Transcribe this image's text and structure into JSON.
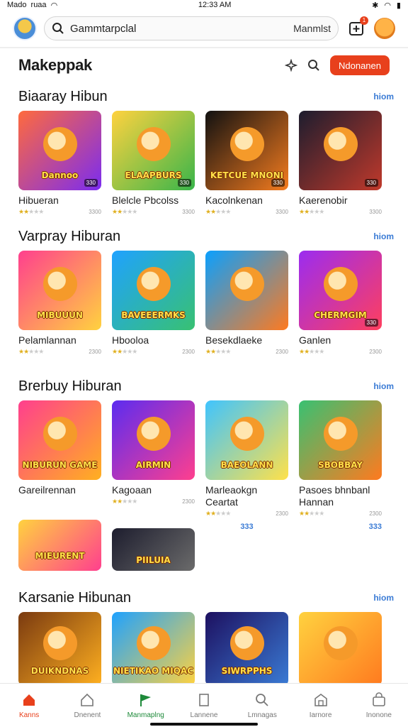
{
  "status_bar": {
    "carrier": "Mado",
    "signal_text": "ruaa",
    "time": "12:33 AM"
  },
  "search": {
    "query": "Gammtarpclal",
    "tag": "Manmlst"
  },
  "notifications_badge": "1",
  "header": {
    "title": "Makeppak",
    "cta": "Ndonanen"
  },
  "sections": [
    {
      "title": "Biaaray Hibun",
      "more": "hiom",
      "items": [
        {
          "name": "Hibueran",
          "thumb_title": "Dannoo",
          "corner": "330",
          "rating": 2,
          "meta": "3300",
          "colors": [
            "#ff6a3d",
            "#7b2cf0"
          ]
        },
        {
          "name": "Blelcle Pbcolss",
          "thumb_title": "ELAAPBURS",
          "corner": "330",
          "rating": 2,
          "meta": "3300",
          "colors": [
            "#ffd23f",
            "#39b54a"
          ]
        },
        {
          "name": "Kacolnkenan",
          "thumb_title": "KETCUE MNONI",
          "corner": "330",
          "rating": 2,
          "meta": "3300",
          "colors": [
            "#111111",
            "#f57c1f"
          ]
        },
        {
          "name": "Kaerenobir",
          "thumb_title": "",
          "corner": "330",
          "rating": 2,
          "meta": "3300",
          "colors": [
            "#1d1d2e",
            "#c0392b"
          ]
        }
      ]
    },
    {
      "title": "Varpray Hiburan",
      "more": "hiom",
      "items": [
        {
          "name": "Pelamlannan",
          "thumb_title": "MIBUUUN",
          "corner": "",
          "rating": 2,
          "meta": "2300",
          "colors": [
            "#ff3f8e",
            "#ffd23f"
          ]
        },
        {
          "name": "Hbooloa",
          "thumb_title": "BAVEEERMKS",
          "corner": "",
          "rating": 2,
          "meta": "2300",
          "colors": [
            "#1fa2ff",
            "#38c172"
          ]
        },
        {
          "name": "Besekdlaeke",
          "thumb_title": "",
          "corner": "",
          "rating": 2,
          "meta": "2300",
          "colors": [
            "#0aa0ff",
            "#ff7a1f"
          ]
        },
        {
          "name": "Ganlen",
          "thumb_title": "CHERMGIM",
          "corner": "330",
          "rating": 2,
          "meta": "2300",
          "colors": [
            "#9b2cf0",
            "#ff3f5e"
          ]
        }
      ]
    },
    {
      "title": "Brerbuy Hiburan",
      "more": "hiom",
      "items": [
        {
          "name": "Gareilrennan",
          "thumb_title": "NIBURUN GAME",
          "corner": "",
          "rating": 0,
          "meta": "",
          "colors": [
            "#ff3f8e",
            "#ffb020"
          ]
        },
        {
          "name": "Kagoaan",
          "thumb_title": "AIRMIN",
          "corner": "",
          "rating": 2,
          "meta": "2300",
          "colors": [
            "#5b2cf0",
            "#ff3f8e"
          ]
        },
        {
          "name": "Marleaokgn Ceartat",
          "thumb_title": "BAEOLANN",
          "corner": "",
          "rating": 2,
          "meta": "2300",
          "colors": [
            "#3fc4ff",
            "#ffe14a"
          ]
        },
        {
          "name": "Pasoes bhnbanl Hannan",
          "thumb_title": "SBOBBAY",
          "corner": "",
          "rating": 2,
          "meta": "2300",
          "colors": [
            "#38c172",
            "#ff7a1f"
          ]
        }
      ],
      "extra": [
        {
          "thumb_title": "MIEURENT",
          "colors": [
            "#ffd23f",
            "#ff3f8e"
          ]
        },
        {
          "thumb_title": "PIILUIA",
          "colors": [
            "#1d1d2e",
            "#6b6b6b"
          ]
        }
      ],
      "prices": [
        "333",
        "333"
      ]
    },
    {
      "title": "Karsanie Hibunan",
      "more": "hiom",
      "items": [
        {
          "name": "",
          "thumb_title": "DUIKNDNAS",
          "corner": "",
          "rating": 0,
          "meta": "",
          "colors": [
            "#7a3a10",
            "#ffb020"
          ]
        },
        {
          "name": "",
          "thumb_title": "NIETIKAO MIQAC",
          "corner": "",
          "rating": 0,
          "meta": "",
          "colors": [
            "#1fa2ff",
            "#ffd23f"
          ]
        },
        {
          "name": "",
          "thumb_title": "SIWRPPHS",
          "corner": "",
          "rating": 0,
          "meta": "",
          "colors": [
            "#1d1060",
            "#3a7bd5"
          ]
        },
        {
          "name": "",
          "thumb_title": "",
          "corner": "",
          "rating": 0,
          "meta": "",
          "colors": [
            "#ffd23f",
            "#ff7a1f"
          ]
        }
      ]
    }
  ],
  "nav": [
    {
      "label": "Kanns",
      "icon": "home-icon",
      "state": "active"
    },
    {
      "label": "Dnenent",
      "icon": "house-icon",
      "state": ""
    },
    {
      "label": "Manmaplng",
      "icon": "flag-icon",
      "state": "green"
    },
    {
      "label": "Lannene",
      "icon": "door-icon",
      "state": ""
    },
    {
      "label": "Lmnagas",
      "icon": "search-icon",
      "state": ""
    },
    {
      "label": "Iarnore",
      "icon": "store-icon",
      "state": ""
    },
    {
      "label": "Inonone",
      "icon": "bag-icon",
      "state": ""
    }
  ]
}
